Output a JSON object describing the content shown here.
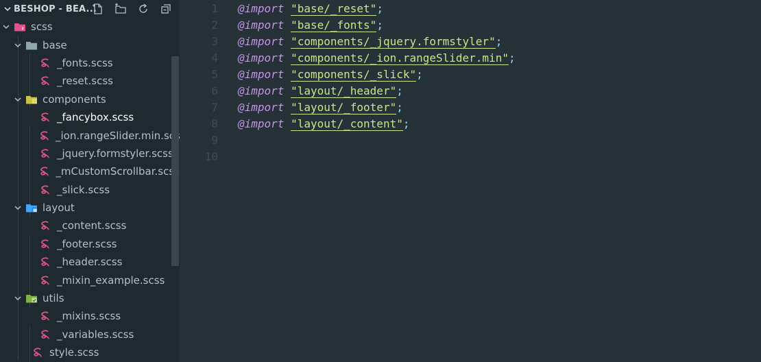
{
  "explorer": {
    "title": "BESHOP - BEA...",
    "actions": [
      {
        "name": "new-file-icon"
      },
      {
        "name": "new-folder-icon"
      },
      {
        "name": "refresh-icon"
      },
      {
        "name": "collapse-all-icon"
      }
    ]
  },
  "tree": [
    {
      "label": "scss",
      "type": "folder",
      "icon": "sass-folder-icon",
      "color": "#e0548d",
      "expanded": true
    },
    {
      "label": "base",
      "type": "folder",
      "icon": "folder-icon",
      "color": "#90a4ae",
      "expanded": true
    },
    {
      "label": "_fonts.scss",
      "type": "file",
      "icon": "sass-icon"
    },
    {
      "label": "_reset.scss",
      "type": "file",
      "icon": "sass-icon"
    },
    {
      "label": "components",
      "type": "folder",
      "icon": "components-folder-icon",
      "color": "#c8c24a",
      "expanded": true
    },
    {
      "label": "_fancybox.scss",
      "type": "file",
      "icon": "sass-icon",
      "active": true
    },
    {
      "label": "_ion.rangeSlider.min.scss",
      "type": "file",
      "icon": "sass-icon"
    },
    {
      "label": "_jquery.formstyler.scss",
      "type": "file",
      "icon": "sass-icon"
    },
    {
      "label": "_mCustomScrollbar.scss",
      "type": "file",
      "icon": "sass-icon"
    },
    {
      "label": "_slick.scss",
      "type": "file",
      "icon": "sass-icon"
    },
    {
      "label": "layout",
      "type": "folder",
      "icon": "layout-folder-icon",
      "color": "#42a5f5",
      "expanded": true
    },
    {
      "label": "_content.scss",
      "type": "file",
      "icon": "sass-icon"
    },
    {
      "label": "_footer.scss",
      "type": "file",
      "icon": "sass-icon"
    },
    {
      "label": "_header.scss",
      "type": "file",
      "icon": "sass-icon"
    },
    {
      "label": "_mixin_example.scss",
      "type": "file",
      "icon": "sass-icon"
    },
    {
      "label": "utils",
      "type": "folder",
      "icon": "utils-folder-icon",
      "color": "#7cb342",
      "expanded": true
    },
    {
      "label": "_mixins.scss",
      "type": "file",
      "icon": "sass-icon"
    },
    {
      "label": "_variables.scss",
      "type": "file",
      "icon": "sass-icon"
    },
    {
      "label": "style.scss",
      "type": "file",
      "icon": "sass-icon"
    }
  ],
  "editor": {
    "keyword": "@import",
    "lines": [
      {
        "num": "1",
        "path": "\"base/_reset\""
      },
      {
        "num": "2",
        "path": "\"base/_fonts\""
      },
      {
        "num": "3",
        "path": "\"components/_jquery.formstyler\""
      },
      {
        "num": "4",
        "path": "\"components/_ion.rangeSlider.min\""
      },
      {
        "num": "5",
        "path": "\"components/_slick\""
      },
      {
        "num": "6",
        "path": "\"layout/_header\""
      },
      {
        "num": "7",
        "path": "\"layout/_footer\""
      },
      {
        "num": "8",
        "path": "\"layout/_content\""
      },
      {
        "num": "9",
        "path": ""
      },
      {
        "num": "10",
        "path": ""
      }
    ],
    "terminator": ";"
  },
  "colors": {
    "sass": "#e0548d",
    "keyword": "#c792ea",
    "string": "#c3e88d",
    "punctuation": "#89ddff",
    "line_number": "#3d4e57"
  }
}
